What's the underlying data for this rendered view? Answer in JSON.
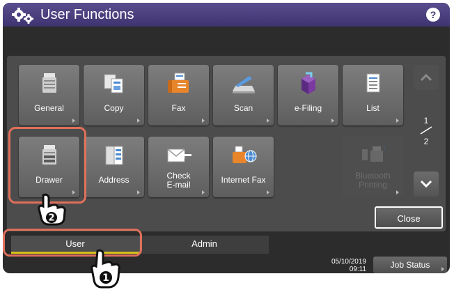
{
  "titlebar": {
    "title": "User Functions",
    "help_label": "?"
  },
  "tiles": [
    {
      "label": "General",
      "icon": "printer-icon",
      "enabled": true
    },
    {
      "label": "Copy",
      "icon": "copy-icon",
      "enabled": true
    },
    {
      "label": "Fax",
      "icon": "fax-icon",
      "enabled": true
    },
    {
      "label": "Scan",
      "icon": "scanner-icon",
      "enabled": true
    },
    {
      "label": "e-Filing",
      "icon": "e-filing-icon",
      "enabled": true
    },
    {
      "label": "List",
      "icon": "list-icon",
      "enabled": true
    },
    {
      "label": "Drawer",
      "icon": "drawer-icon",
      "enabled": true
    },
    {
      "label": "Address",
      "icon": "address-book-icon",
      "enabled": true
    },
    {
      "label_line1": "Check",
      "label_line2": "E-mail",
      "icon": "envelope-icon",
      "enabled": true
    },
    {
      "label": "Internet Fax",
      "icon": "internet-fax-icon",
      "enabled": true
    },
    {
      "label_line1": "Bluetooth",
      "label_line2": "Printing",
      "icon": "bluetooth-printer-icon",
      "enabled": false
    }
  ],
  "pager": {
    "current": "1",
    "total": "2"
  },
  "buttons": {
    "close": "Close",
    "job_status": "Job Status"
  },
  "tabs": {
    "user": "User",
    "admin": "Admin"
  },
  "status": {
    "date": "05/10/2019",
    "time": "09:11"
  },
  "callouts": {
    "step1": "1",
    "step2": "2"
  },
  "colors": {
    "titlebar": "#4a3f80",
    "callout": "#e0705a",
    "active_tab_underline": "#d6c21c"
  }
}
